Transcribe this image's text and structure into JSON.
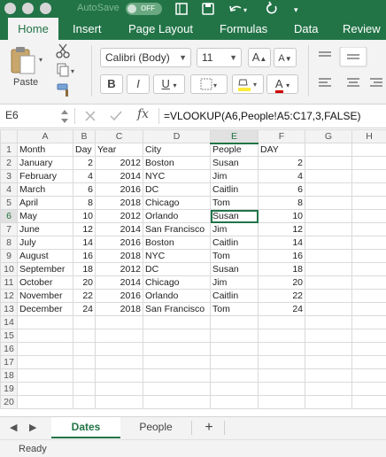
{
  "titlebar": {
    "autosave_label": "AutoSave",
    "autosave_state": "OFF",
    "colors": {
      "bar": "#227447"
    }
  },
  "ribbon": {
    "tabs": [
      "Home",
      "Insert",
      "Page Layout",
      "Formulas",
      "Data",
      "Review"
    ],
    "active_tab": "Home",
    "paste_label": "Paste",
    "font_name": "Calibri (Body)",
    "font_size": "11",
    "increase_font_label": "A",
    "decrease_font_label": "A",
    "bold_label": "B",
    "italic_label": "I",
    "underline_label": "U",
    "font_color_label": "A",
    "colors": {
      "highlight": "#ffeb3b",
      "font_color": "#d00000"
    }
  },
  "formula_bar": {
    "name_box": "E6",
    "fx": "fx",
    "formula": "=VLOOKUP(A6,People!A5:C17,3,FALSE)"
  },
  "grid": {
    "columns": [
      "A",
      "B",
      "C",
      "D",
      "E",
      "F",
      "G",
      "H"
    ],
    "selected_column": "E",
    "selected_row": "6",
    "rows": [
      {
        "n": "1",
        "cells": [
          "Month",
          "Day",
          "Year",
          "City",
          "People",
          "DAY",
          "",
          ""
        ]
      },
      {
        "n": "2",
        "cells": [
          "January",
          "2",
          "2012",
          "Boston",
          "Susan",
          "2",
          "",
          ""
        ]
      },
      {
        "n": "3",
        "cells": [
          "February",
          "4",
          "2014",
          "NYC",
          "Jim",
          "4",
          "",
          ""
        ]
      },
      {
        "n": "4",
        "cells": [
          "March",
          "6",
          "2016",
          "DC",
          "Caitlin",
          "6",
          "",
          ""
        ]
      },
      {
        "n": "5",
        "cells": [
          "April",
          "8",
          "2018",
          "Chicago",
          "Tom",
          "8",
          "",
          ""
        ]
      },
      {
        "n": "6",
        "cells": [
          "May",
          "10",
          "2012",
          "Orlando",
          "Susan",
          "10",
          "",
          ""
        ]
      },
      {
        "n": "7",
        "cells": [
          "June",
          "12",
          "2014",
          "San Francisco",
          "Jim",
          "12",
          "",
          ""
        ]
      },
      {
        "n": "8",
        "cells": [
          "July",
          "14",
          "2016",
          "Boston",
          "Caitlin",
          "14",
          "",
          ""
        ]
      },
      {
        "n": "9",
        "cells": [
          "August",
          "16",
          "2018",
          "NYC",
          "Tom",
          "16",
          "",
          ""
        ]
      },
      {
        "n": "10",
        "cells": [
          "September",
          "18",
          "2012",
          "DC",
          "Susan",
          "18",
          "",
          ""
        ]
      },
      {
        "n": "11",
        "cells": [
          "October",
          "20",
          "2014",
          "Chicago",
          "Jim",
          "20",
          "",
          ""
        ]
      },
      {
        "n": "12",
        "cells": [
          "November",
          "22",
          "2016",
          "Orlando",
          "Caitlin",
          "22",
          "",
          ""
        ]
      },
      {
        "n": "13",
        "cells": [
          "December",
          "24",
          "2018",
          "San Francisco",
          "Tom",
          "24",
          "",
          ""
        ]
      },
      {
        "n": "14",
        "cells": [
          "",
          "",
          "",
          "",
          "",
          "",
          "",
          ""
        ]
      },
      {
        "n": "15",
        "cells": [
          "",
          "",
          "",
          "",
          "",
          "",
          "",
          ""
        ]
      },
      {
        "n": "16",
        "cells": [
          "",
          "",
          "",
          "",
          "",
          "",
          "",
          ""
        ]
      },
      {
        "n": "17",
        "cells": [
          "",
          "",
          "",
          "",
          "",
          "",
          "",
          ""
        ]
      },
      {
        "n": "18",
        "cells": [
          "",
          "",
          "",
          "",
          "",
          "",
          "",
          ""
        ]
      },
      {
        "n": "19",
        "cells": [
          "",
          "",
          "",
          "",
          "",
          "",
          "",
          ""
        ]
      },
      {
        "n": "20",
        "cells": [
          "",
          "",
          "",
          "",
          "",
          "",
          "",
          ""
        ]
      }
    ]
  },
  "sheets": {
    "tabs": [
      "Dates",
      "People"
    ],
    "active": "Dates",
    "add_label": "+"
  },
  "status": {
    "text": "Ready"
  }
}
